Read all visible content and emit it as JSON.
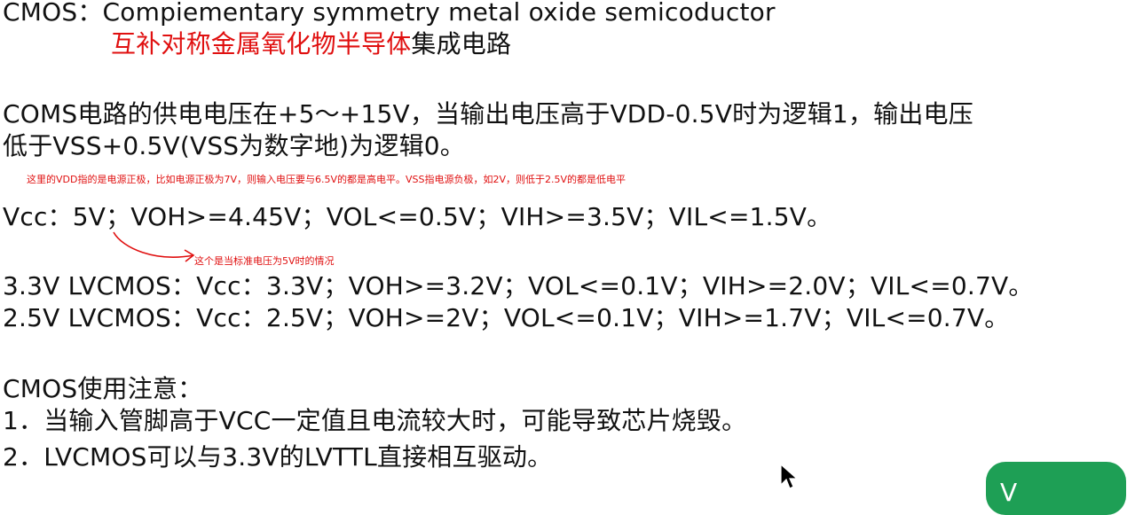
{
  "line1": "CMOS：Compiementary symmetry metal oxide semicoductor",
  "line2_red": "互补对称金属氧化物半导体",
  "line2_black": "集成电路",
  "para1_line1": "COMS电路的供电电压在+5～+15V，当输出电压高于VDD-0.5V时为逻辑1，输出电压",
  "para1_line2": "低于VSS+0.5V(VSS为数字地)为逻辑0。",
  "note1": "这里的VDD指的是电源正极，比如电源正极为7V，则输入电压要与6.5V的都是高电平。VSS指电源负极，如2V，则低于2.5V的都是低电平",
  "vcc5_line": "Vcc：5V；VOH>=4.45V；VOL<=0.5V；VIH>=3.5V；VIL<=1.5V。",
  "note2": "这个是当标准电压为5V时的情况",
  "lv33_line": "3.3V LVCMOS：Vcc：3.3V；VOH>=3.2V；VOL<=0.1V；VIH>=2.0V；VIL<=0.7V。",
  "lv25_line": "2.5V LVCMOS：Vcc：2.5V；VOH>=2V；VOL<=0.1V；VIH>=1.7V；VIL<=0.7V。",
  "notes_title": "CMOS使用注意：",
  "note_item1": "1．当输入管脚高于VCC一定值且电流较大时，可能导致芯片烧毁。",
  "note_item2": "2．LVCMOS可以与3.3V的LVTTL直接相互驱动。",
  "floating_button_text": "V",
  "colors": {
    "annotation_red": "#e01010",
    "button_green": "#1e9f55"
  },
  "icons": {
    "cursor": "arrow-cursor-icon"
  }
}
